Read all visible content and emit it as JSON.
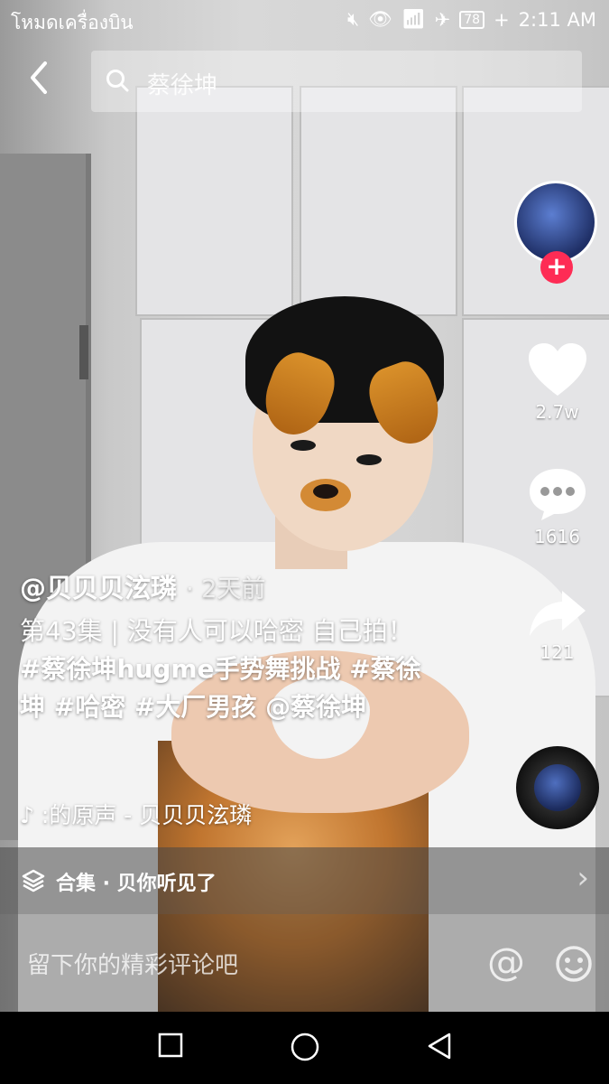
{
  "status_bar": {
    "carrier": "โหมดเครื่องบิน",
    "battery": "78",
    "time": "2:11 AM"
  },
  "search": {
    "query": "蔡徐坤"
  },
  "actions": {
    "likes": "2.7w",
    "comments": "1616",
    "shares": "121"
  },
  "post": {
    "author": "@贝贝贝泫璘",
    "time_ago": "· 2天前",
    "description": "第43集 | 没有人可以哈密 自己拍！",
    "tags": "#蔡徐坤hugme手势舞挑战 #蔡徐坤 #哈密 #大厂男孩 @蔡徐坤",
    "sound": ":的原声 - 贝贝贝泫璘"
  },
  "collection": {
    "label": "合集 · 贝你听见了"
  },
  "comment_input": {
    "placeholder": "留下你的精彩评论吧",
    "at_symbol": "@"
  },
  "icons": {
    "back": "back-arrow-icon",
    "search": "search-icon",
    "like": "heart-icon",
    "comment": "comment-bubble-icon",
    "share": "share-arrow-icon",
    "music": "music-note-icon",
    "collection": "layers-icon",
    "emoji": "smiley-icon"
  },
  "colors": {
    "follow_accent": "#fe2c55"
  }
}
